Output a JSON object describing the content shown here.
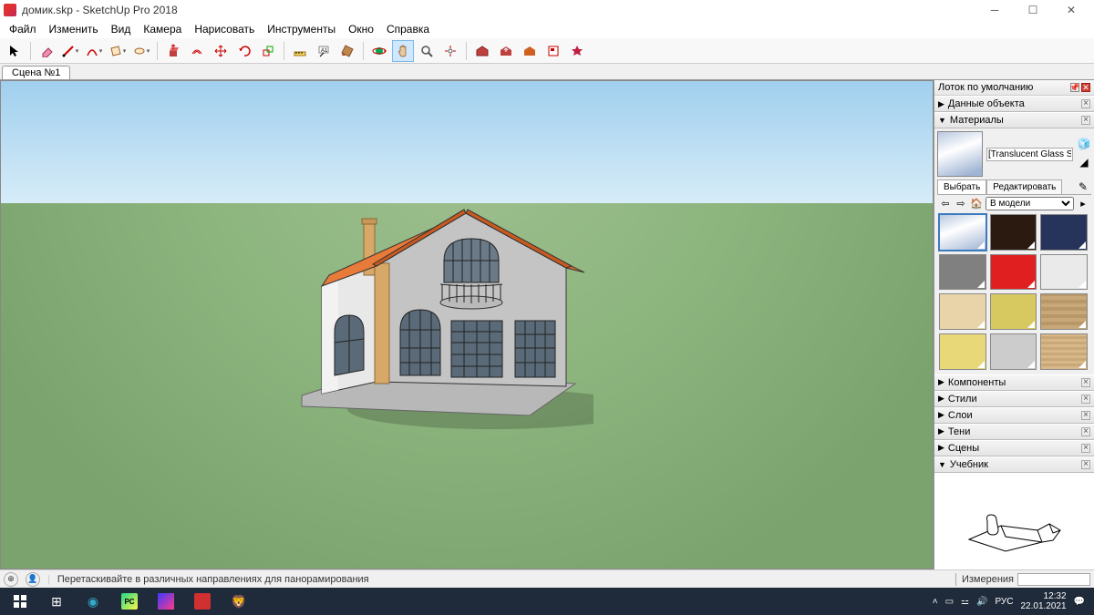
{
  "window": {
    "title": "домик.skp - SketchUp Pro 2018"
  },
  "menu": [
    "Файл",
    "Изменить",
    "Вид",
    "Камера",
    "Нарисовать",
    "Инструменты",
    "Окно",
    "Справка"
  ],
  "scenetab": "Сцена №1",
  "tray": {
    "title": "Лоток по умолчанию",
    "panels": {
      "entity": "Данные объекта",
      "materials": "Материалы",
      "components": "Компоненты",
      "styles": "Стили",
      "layers": "Слои",
      "shadows": "Тени",
      "scenes": "Сцены",
      "instructor": "Учебник"
    },
    "material_name": "[Translucent Glass Sky Ref",
    "subtabs": {
      "select": "Выбрать",
      "edit": "Редактировать"
    },
    "dropdown": "В модели",
    "swatches": [
      {
        "bg": "linear-gradient(160deg,#b8c8e0,#fff 40%,#a0b4d4)",
        "selected": true
      },
      {
        "bg": "#2a1a10"
      },
      {
        "bg": "#26335a"
      },
      {
        "bg": "#808080"
      },
      {
        "bg": "#e02020"
      },
      {
        "bg": "#eaeaea"
      },
      {
        "bg": "#e8d4a8"
      },
      {
        "bg": "#d8c860"
      },
      {
        "bg": "repeating-linear-gradient(0deg,#c8a878,#c8a878 4px,#b89868 4px,#b89868 8px)"
      },
      {
        "bg": "#e8d878"
      },
      {
        "bg": "#ccc"
      },
      {
        "bg": "repeating-linear-gradient(0deg,#d8b888,#d8b888 3px,#c8a878 3px,#c8a878 6px)"
      }
    ]
  },
  "statusbar": {
    "hint": "Перетаскивайте в различных направлениях для панорамирования",
    "measure_label": "Измерения"
  },
  "taskbar": {
    "lang": "РУС",
    "time": "12:32",
    "date": "22.01.2021"
  }
}
